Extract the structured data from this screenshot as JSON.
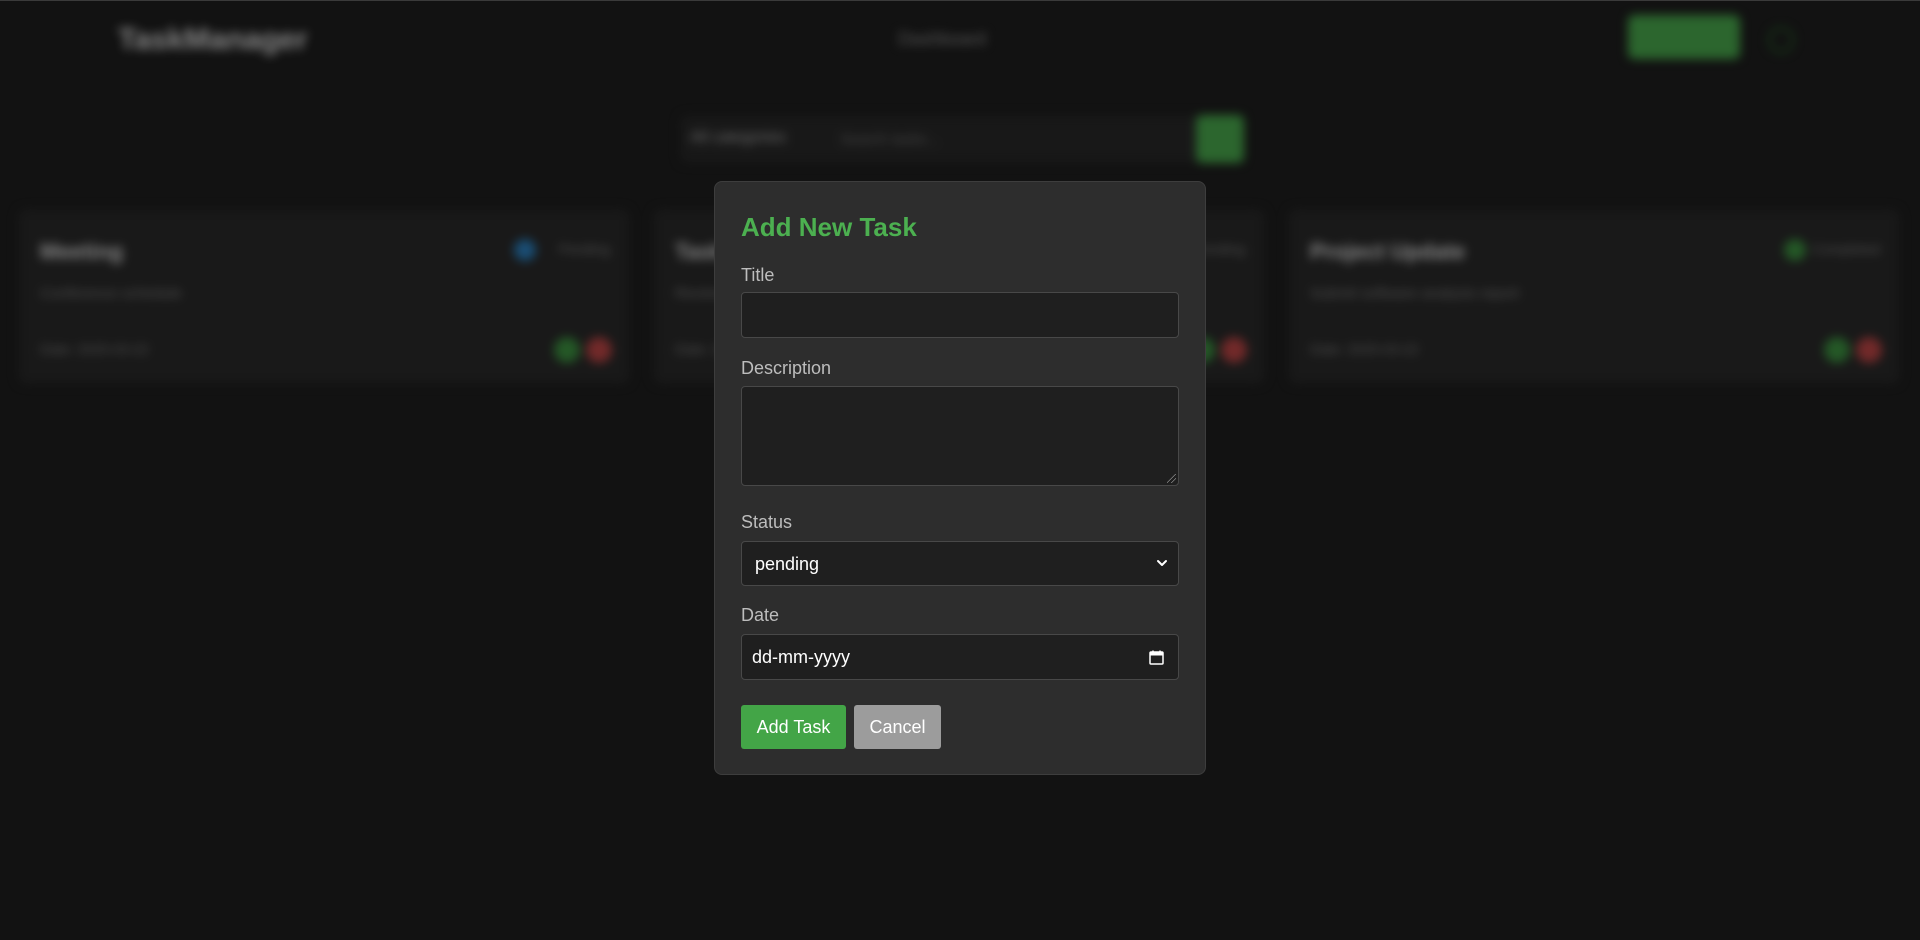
{
  "background": {
    "logo": "TaskManager",
    "nav_label": "Dashboard",
    "search_filter": "All categories",
    "search_placeholder": "Search tasks...",
    "cards": [
      {
        "title": "Meeting",
        "description": "Conference schedule",
        "date": "Date: 2025-03-22",
        "status": "Pending"
      },
      {
        "title": "Task",
        "description": "Review notes",
        "date": "Date: 2025-03-22",
        "status": "Pending"
      },
      {
        "title": "Project Update",
        "description": "Submit software analysis report",
        "date": "Date: 2025-03-22",
        "status": "Completed"
      }
    ]
  },
  "modal": {
    "heading": "Add New Task",
    "title_label": "Title",
    "title_value": "",
    "description_label": "Description",
    "description_value": "",
    "status_label": "Status",
    "status_value": "pending",
    "date_label": "Date",
    "date_placeholder": "dd-mm-yyyy",
    "add_button": "Add Task",
    "cancel_button": "Cancel"
  },
  "icons": {
    "status_select": "chevron-down-icon",
    "date_picker": "calendar-icon"
  },
  "colors": {
    "accent": "#4cb050",
    "page_background": "#1f1f1f",
    "modal_background": "#2d2d2d",
    "cancel_button": "#9c9c9c",
    "delete_red": "#c44848",
    "info_blue": "#2d86c8"
  }
}
